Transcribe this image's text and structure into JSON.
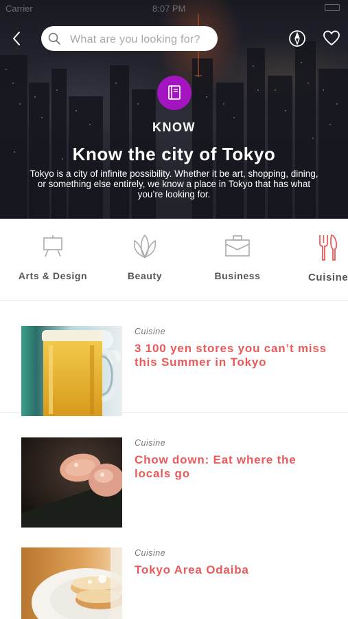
{
  "status_bar": {
    "carrier": "Carrier",
    "time": "8:07 PM"
  },
  "header": {
    "search": {
      "placeholder": "What are you looking for?"
    },
    "icons": {
      "back": "chevron-left-icon",
      "search": "search-icon",
      "compass": "compass-icon",
      "favorites": "heart-icon"
    }
  },
  "hero": {
    "section_label": "KNOW",
    "section_icon": "book-icon",
    "title": "Know the city of Tokyo",
    "description": "Tokyo is a city of infinite possibility. Whether it be art, shopping, dining, or something else entirely, we know a place in Tokyo that has what you’re looking for.",
    "badge_color": "#a414c0"
  },
  "categories": [
    {
      "label": "Arts & Design",
      "icon": "easel-icon",
      "active": false
    },
    {
      "label": "Beauty",
      "icon": "lotus-icon",
      "active": false
    },
    {
      "label": "Business",
      "icon": "briefcase-icon",
      "active": false
    },
    {
      "label": "Cuisine",
      "icon": "fork-knife-icon",
      "active": true
    }
  ],
  "accent_color": "#ea5a5a",
  "articles": [
    {
      "category": "Cuisine",
      "title": "3 100 yen stores you can’t miss this Summer in Tokyo",
      "image": "beer-mug-photo"
    },
    {
      "category": "Cuisine",
      "title": "Chow down: Eat where the locals go",
      "image": "sushi-photo"
    },
    {
      "category": "Cuisine",
      "title": "Tokyo Area Odaiba",
      "image": "pancakes-photo"
    }
  ]
}
